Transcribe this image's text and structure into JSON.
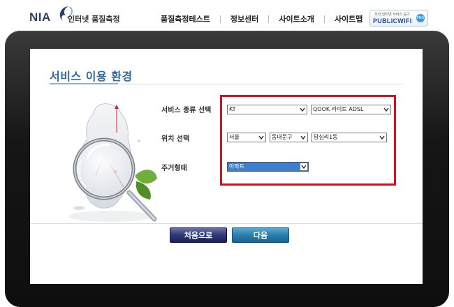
{
  "header": {
    "logo": {
      "brand": "NIA",
      "subtitle": "인터넷 품질측정"
    },
    "nav": [
      {
        "label": "품질측정테스트"
      },
      {
        "label": "정보센터"
      },
      {
        "label": "사이트소개"
      },
      {
        "label": "사이트맵"
      }
    ],
    "badge": {
      "small_text": "우리 인터넷 서비스 공기",
      "main_text": "PUBLICWIFI",
      "dot_text": "PRO"
    }
  },
  "page": {
    "title": "서비스 이용 환경",
    "form": {
      "service_label": "서비스 종류 선택",
      "location_label": "위치 선택",
      "housing_label": "주거형태",
      "service_provider": {
        "value": "KT"
      },
      "service_product": {
        "value": "QOOK 라이트 ADSL"
      },
      "location_city": {
        "value": "서울"
      },
      "location_district": {
        "value": "동대문구"
      },
      "location_dong": {
        "value": "답십리1동"
      },
      "housing_type": {
        "value": "아파트"
      }
    },
    "buttons": {
      "home_label": "처음으로",
      "next_label": "다음"
    }
  },
  "colors": {
    "accent_title": "#2d6a9f",
    "highlight_border": "#d8101e",
    "selected_option": "#3c7fd1",
    "btn_home": "#2f3875",
    "btn_next": "#2a7fae"
  },
  "icons": [
    "magnifier-map-illustration",
    "chevron-down-icon"
  ]
}
